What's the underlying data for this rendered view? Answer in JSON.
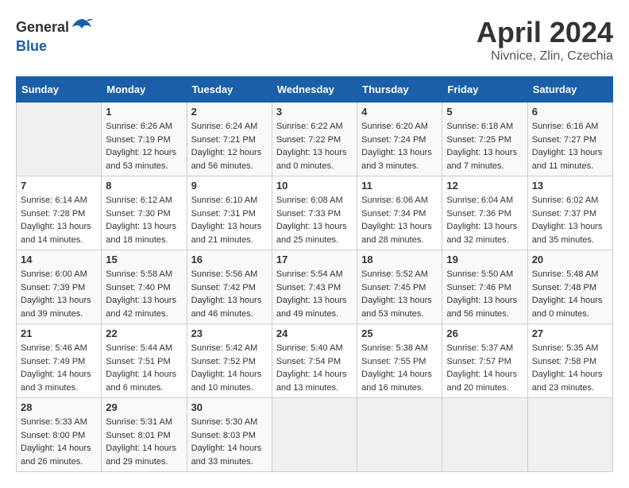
{
  "header": {
    "logo_general": "General",
    "logo_blue": "Blue",
    "month": "April 2024",
    "location": "Nivnice, Zlin, Czechia"
  },
  "columns": [
    "Sunday",
    "Monday",
    "Tuesday",
    "Wednesday",
    "Thursday",
    "Friday",
    "Saturday"
  ],
  "weeks": [
    [
      {
        "day": "",
        "info": ""
      },
      {
        "day": "1",
        "info": "Sunrise: 6:26 AM\nSunset: 7:19 PM\nDaylight: 12 hours\nand 53 minutes."
      },
      {
        "day": "2",
        "info": "Sunrise: 6:24 AM\nSunset: 7:21 PM\nDaylight: 12 hours\nand 56 minutes."
      },
      {
        "day": "3",
        "info": "Sunrise: 6:22 AM\nSunset: 7:22 PM\nDaylight: 13 hours\nand 0 minutes."
      },
      {
        "day": "4",
        "info": "Sunrise: 6:20 AM\nSunset: 7:24 PM\nDaylight: 13 hours\nand 3 minutes."
      },
      {
        "day": "5",
        "info": "Sunrise: 6:18 AM\nSunset: 7:25 PM\nDaylight: 13 hours\nand 7 minutes."
      },
      {
        "day": "6",
        "info": "Sunrise: 6:16 AM\nSunset: 7:27 PM\nDaylight: 13 hours\nand 11 minutes."
      }
    ],
    [
      {
        "day": "7",
        "info": "Sunrise: 6:14 AM\nSunset: 7:28 PM\nDaylight: 13 hours\nand 14 minutes."
      },
      {
        "day": "8",
        "info": "Sunrise: 6:12 AM\nSunset: 7:30 PM\nDaylight: 13 hours\nand 18 minutes."
      },
      {
        "day": "9",
        "info": "Sunrise: 6:10 AM\nSunset: 7:31 PM\nDaylight: 13 hours\nand 21 minutes."
      },
      {
        "day": "10",
        "info": "Sunrise: 6:08 AM\nSunset: 7:33 PM\nDaylight: 13 hours\nand 25 minutes."
      },
      {
        "day": "11",
        "info": "Sunrise: 6:06 AM\nSunset: 7:34 PM\nDaylight: 13 hours\nand 28 minutes."
      },
      {
        "day": "12",
        "info": "Sunrise: 6:04 AM\nSunset: 7:36 PM\nDaylight: 13 hours\nand 32 minutes."
      },
      {
        "day": "13",
        "info": "Sunrise: 6:02 AM\nSunset: 7:37 PM\nDaylight: 13 hours\nand 35 minutes."
      }
    ],
    [
      {
        "day": "14",
        "info": "Sunrise: 6:00 AM\nSunset: 7:39 PM\nDaylight: 13 hours\nand 39 minutes."
      },
      {
        "day": "15",
        "info": "Sunrise: 5:58 AM\nSunset: 7:40 PM\nDaylight: 13 hours\nand 42 minutes."
      },
      {
        "day": "16",
        "info": "Sunrise: 5:56 AM\nSunset: 7:42 PM\nDaylight: 13 hours\nand 46 minutes."
      },
      {
        "day": "17",
        "info": "Sunrise: 5:54 AM\nSunset: 7:43 PM\nDaylight: 13 hours\nand 49 minutes."
      },
      {
        "day": "18",
        "info": "Sunrise: 5:52 AM\nSunset: 7:45 PM\nDaylight: 13 hours\nand 53 minutes."
      },
      {
        "day": "19",
        "info": "Sunrise: 5:50 AM\nSunset: 7:46 PM\nDaylight: 13 hours\nand 56 minutes."
      },
      {
        "day": "20",
        "info": "Sunrise: 5:48 AM\nSunset: 7:48 PM\nDaylight: 14 hours\nand 0 minutes."
      }
    ],
    [
      {
        "day": "21",
        "info": "Sunrise: 5:46 AM\nSunset: 7:49 PM\nDaylight: 14 hours\nand 3 minutes."
      },
      {
        "day": "22",
        "info": "Sunrise: 5:44 AM\nSunset: 7:51 PM\nDaylight: 14 hours\nand 6 minutes."
      },
      {
        "day": "23",
        "info": "Sunrise: 5:42 AM\nSunset: 7:52 PM\nDaylight: 14 hours\nand 10 minutes."
      },
      {
        "day": "24",
        "info": "Sunrise: 5:40 AM\nSunset: 7:54 PM\nDaylight: 14 hours\nand 13 minutes."
      },
      {
        "day": "25",
        "info": "Sunrise: 5:38 AM\nSunset: 7:55 PM\nDaylight: 14 hours\nand 16 minutes."
      },
      {
        "day": "26",
        "info": "Sunrise: 5:37 AM\nSunset: 7:57 PM\nDaylight: 14 hours\nand 20 minutes."
      },
      {
        "day": "27",
        "info": "Sunrise: 5:35 AM\nSunset: 7:58 PM\nDaylight: 14 hours\nand 23 minutes."
      }
    ],
    [
      {
        "day": "28",
        "info": "Sunrise: 5:33 AM\nSunset: 8:00 PM\nDaylight: 14 hours\nand 26 minutes."
      },
      {
        "day": "29",
        "info": "Sunrise: 5:31 AM\nSunset: 8:01 PM\nDaylight: 14 hours\nand 29 minutes."
      },
      {
        "day": "30",
        "info": "Sunrise: 5:30 AM\nSunset: 8:03 PM\nDaylight: 14 hours\nand 33 minutes."
      },
      {
        "day": "",
        "info": ""
      },
      {
        "day": "",
        "info": ""
      },
      {
        "day": "",
        "info": ""
      },
      {
        "day": "",
        "info": ""
      }
    ]
  ]
}
